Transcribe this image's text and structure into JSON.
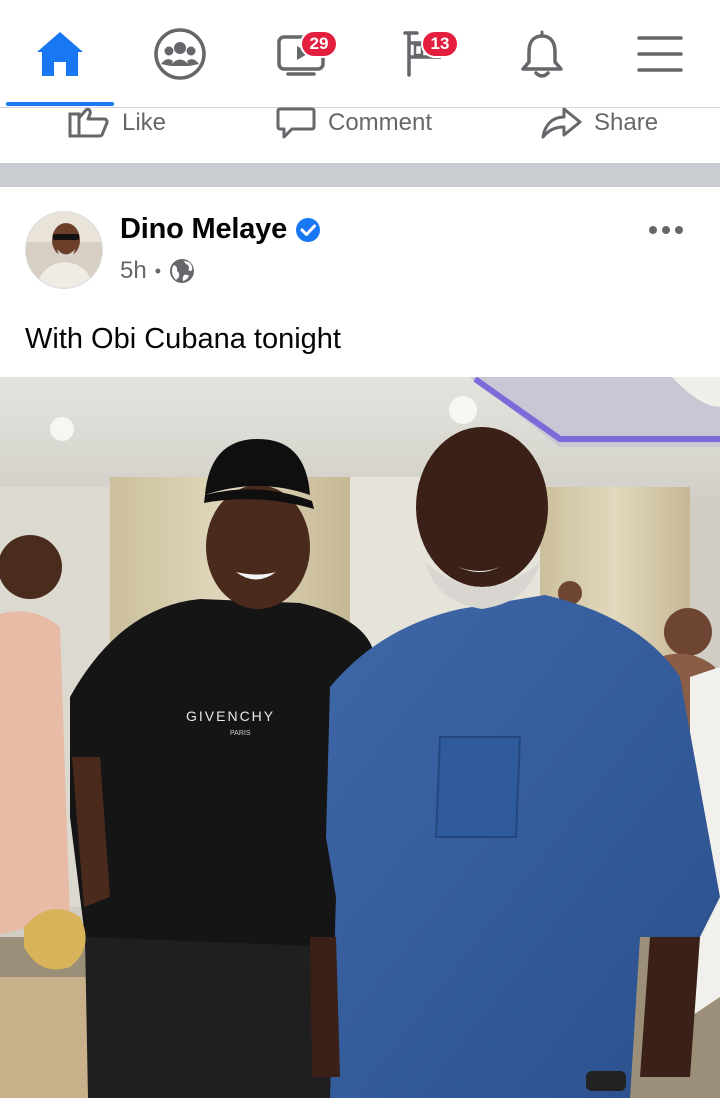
{
  "nav": {
    "items": [
      {
        "name": "home-icon",
        "active": true
      },
      {
        "name": "groups-icon"
      },
      {
        "name": "watch-icon",
        "badge": "29"
      },
      {
        "name": "marketplace-icon",
        "badge": "13"
      },
      {
        "name": "notifications-bell-icon"
      },
      {
        "name": "menu-hamburger-icon"
      }
    ],
    "watch_badge": "29",
    "marketplace_badge": "13"
  },
  "actions": {
    "like_label": "Like",
    "comment_label": "Comment",
    "share_label": "Share"
  },
  "post": {
    "author": "Dino Melaye",
    "verified": true,
    "time": "5h",
    "separator": "•",
    "audience_icon": "globe-icon",
    "text": "With Obi Cubana tonight",
    "more_icon": "more-horizontal-icon",
    "photo_shirt_text": "GIVENCHY",
    "photo_shirt_subtext": "PARIS"
  },
  "colors": {
    "accent": "#1877f2",
    "badge": "#e41e3f",
    "icon_gray": "#65676b",
    "separator": "#c9ccd1"
  }
}
